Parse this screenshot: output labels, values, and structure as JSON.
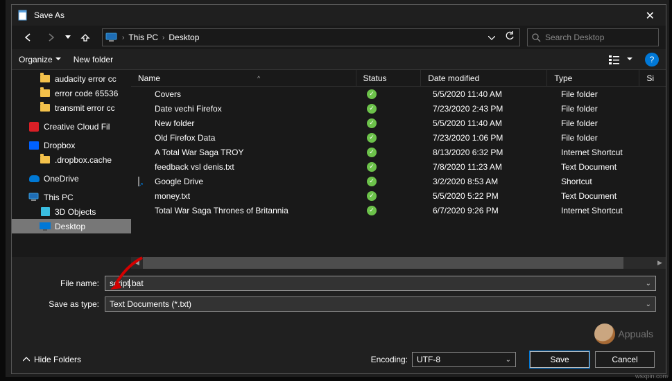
{
  "window": {
    "title": "Save As"
  },
  "nav": {
    "crumbs": [
      "This PC",
      "Desktop"
    ],
    "search_placeholder": "Search Desktop"
  },
  "toolbar": {
    "organize": "Organize",
    "new_folder": "New folder"
  },
  "sidebar": {
    "items": [
      {
        "label": "audacity error cc",
        "icon": "folder",
        "lvl": 2
      },
      {
        "label": "error code 65536",
        "icon": "folder",
        "lvl": 2
      },
      {
        "label": "transmit error cc",
        "icon": "folder",
        "lvl": 2
      },
      {
        "label": "Creative Cloud Fil",
        "icon": "cc",
        "lvl": 1
      },
      {
        "label": "Dropbox",
        "icon": "dropbox",
        "lvl": 1
      },
      {
        "label": ".dropbox.cache",
        "icon": "folder",
        "lvl": 2
      },
      {
        "label": "OneDrive",
        "icon": "onedrive",
        "lvl": 1
      },
      {
        "label": "This PC",
        "icon": "thispc",
        "lvl": 1
      },
      {
        "label": "3D Objects",
        "icon": "3d",
        "lvl": 2
      },
      {
        "label": "Desktop",
        "icon": "desktop",
        "lvl": 2,
        "selected": true
      }
    ]
  },
  "columns": {
    "name": "Name",
    "status": "Status",
    "date": "Date modified",
    "type": "Type",
    "size": "Si"
  },
  "sort_indicator": "^",
  "files": [
    {
      "name": "Covers",
      "icon": "folder",
      "status": "ok",
      "date": "5/5/2020 11:40 AM",
      "type": "File folder"
    },
    {
      "name": "Date vechi Firefox",
      "icon": "folder",
      "status": "ok",
      "date": "7/23/2020 2:43 PM",
      "type": "File folder"
    },
    {
      "name": "New folder",
      "icon": "folder",
      "status": "ok",
      "date": "5/5/2020 11:40 AM",
      "type": "File folder"
    },
    {
      "name": "Old Firefox Data",
      "icon": "folder",
      "status": "ok",
      "date": "7/23/2020 1:06 PM",
      "type": "File folder"
    },
    {
      "name": "A Total War Saga TROY",
      "icon": "link",
      "status": "ok",
      "date": "8/13/2020 6:32 PM",
      "type": "Internet Shortcut"
    },
    {
      "name": "feedback vsl denis.txt",
      "icon": "txt",
      "status": "ok",
      "date": "7/8/2020 11:23 AM",
      "type": "Text Document"
    },
    {
      "name": "Google Drive",
      "icon": "shortcut",
      "status": "ok",
      "date": "3/2/2020 8:53 AM",
      "type": "Shortcut"
    },
    {
      "name": "money.txt",
      "icon": "txt",
      "status": "ok",
      "date": "5/5/2020 5:22 PM",
      "type": "Text Document"
    },
    {
      "name": "Total War Saga Thrones of Britannia",
      "icon": "image",
      "status": "ok",
      "date": "6/7/2020 9:26 PM",
      "type": "Internet Shortcut"
    }
  ],
  "form": {
    "filename_label": "File name:",
    "filename_value": "script.bat",
    "filetype_label": "Save as type:",
    "filetype_value": "Text Documents (*.txt)"
  },
  "bottom": {
    "hide_folders": "Hide Folders",
    "encoding_label": "Encoding:",
    "encoding_value": "UTF-8",
    "save": "Save",
    "cancel": "Cancel"
  },
  "watermark": {
    "text": "Appuals",
    "src": "wsxpin.com"
  }
}
